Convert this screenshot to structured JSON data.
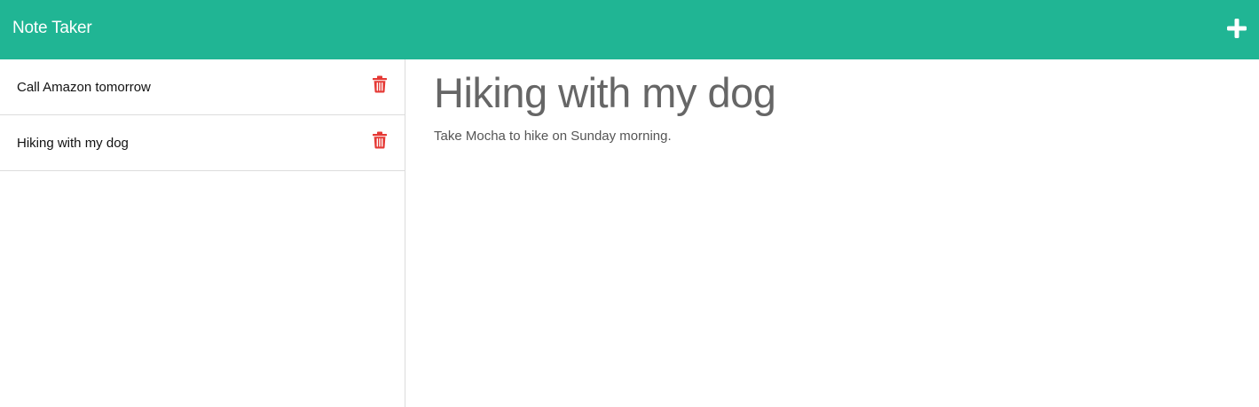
{
  "navbar": {
    "brand": "Note Taker",
    "add_icon": "plus-icon",
    "background": "#20b594"
  },
  "sidebar": {
    "notes": [
      {
        "title": "Call Amazon tomorrow",
        "delete_icon": "trash-icon"
      },
      {
        "title": "Hiking with my dog",
        "delete_icon": "trash-icon"
      }
    ],
    "delete_color": "#e53935"
  },
  "main": {
    "title": "Hiking with my dog",
    "text": "Take Mocha to hike on Sunday morning."
  }
}
